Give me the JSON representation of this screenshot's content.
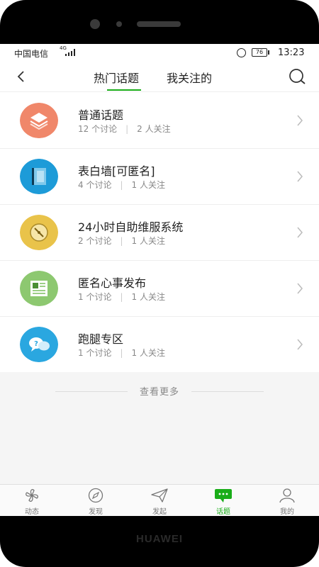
{
  "device": {
    "brand": "HUAWEI"
  },
  "status_bar": {
    "carrier": "中国电信",
    "network": "4G",
    "battery": "76",
    "time": "13:23"
  },
  "header": {
    "tabs": [
      {
        "label": "热门话题",
        "active": true
      },
      {
        "label": "我关注的",
        "active": false
      }
    ],
    "accent_color": "#1aad19"
  },
  "topics": [
    {
      "title": "普通话题",
      "discussions": "12 个讨论",
      "followers": "2 人关注",
      "icon": "stack-icon",
      "color": "#f0876a"
    },
    {
      "title": "表白墙[可匿名]",
      "discussions": "4 个讨论",
      "followers": "1 人关注",
      "icon": "notebook-icon",
      "color": "#1d9bd8"
    },
    {
      "title": "24小时自助维服系统",
      "discussions": "2 个讨论",
      "followers": "1 人关注",
      "icon": "compass-icon",
      "color": "#e9c34a"
    },
    {
      "title": "匿名心事发布",
      "discussions": "1 个讨论",
      "followers": "1 人关注",
      "icon": "article-icon",
      "color": "#8dc870"
    },
    {
      "title": "跑腿专区",
      "discussions": "1 个讨论",
      "followers": "1 人关注",
      "icon": "chat-bubbles-icon",
      "color": "#2aa7e0"
    }
  ],
  "more": {
    "label": "查看更多"
  },
  "bottom_nav": [
    {
      "label": "动态",
      "icon": "pinwheel-icon",
      "active": false
    },
    {
      "label": "发现",
      "icon": "compass-icon",
      "active": false
    },
    {
      "label": "发起",
      "icon": "send-icon",
      "active": false
    },
    {
      "label": "话题",
      "icon": "chat-icon",
      "active": true
    },
    {
      "label": "我的",
      "icon": "person-icon",
      "active": false
    }
  ]
}
